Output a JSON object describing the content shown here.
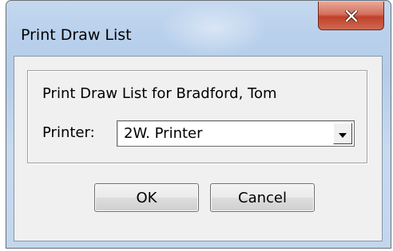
{
  "window": {
    "title": "Print Draw List",
    "close_glyph": "x"
  },
  "group": {
    "title": "Print Draw List for Bradford, Tom"
  },
  "printer": {
    "label": "Printer:",
    "selected": "2W. Printer"
  },
  "buttons": {
    "ok_label": "OK",
    "cancel_label": "Cancel"
  },
  "colors": {
    "close_button": "#c7503a",
    "frame": "#b9d0ec",
    "client": "#f0f0f0"
  },
  "icons": {
    "close": "close-icon",
    "dropdown": "chevron-down-icon"
  }
}
